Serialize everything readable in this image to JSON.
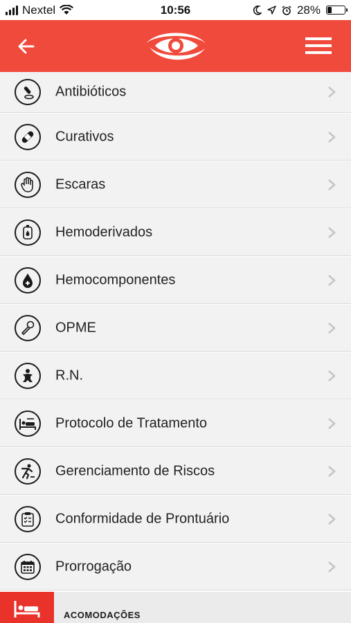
{
  "status_bar": {
    "carrier": "Nextel",
    "time": "10:56",
    "battery": "28%",
    "battery_level": 0.28,
    "icons": [
      "signal-icon",
      "wifi-icon",
      "moon-icon",
      "location-icon",
      "alarm-icon",
      "battery-icon"
    ]
  },
  "header": {
    "background": "#f04a3c",
    "back_icon": "arrow-left-icon",
    "logo_icon": "eye-logo-icon",
    "menu_icon": "hamburger-icon"
  },
  "list": {
    "items": [
      {
        "label": "Antibióticos",
        "icon": "pill-icon"
      },
      {
        "label": "Curativos",
        "icon": "bandage-icon"
      },
      {
        "label": "Escaras",
        "icon": "hand-icon"
      },
      {
        "label": "Hemoderivados",
        "icon": "blood-bag-icon"
      },
      {
        "label": "Hemocomponentes",
        "icon": "blood-drop-icon"
      },
      {
        "label": "OPME",
        "icon": "tool-icon"
      },
      {
        "label": "R.N.",
        "icon": "baby-icon"
      },
      {
        "label": "Protocolo de Tratamento",
        "icon": "hospital-bed-icon"
      },
      {
        "label": "Gerenciamento de Riscos",
        "icon": "fall-risk-icon"
      },
      {
        "label": "Conformidade de Prontuário",
        "icon": "clipboard-icon"
      },
      {
        "label": "Prorrogação",
        "icon": "calendar-icon"
      }
    ]
  },
  "section": {
    "title": "ACOMODAÇÕES",
    "icon": "bed-icon",
    "accent": "#e8322a"
  }
}
